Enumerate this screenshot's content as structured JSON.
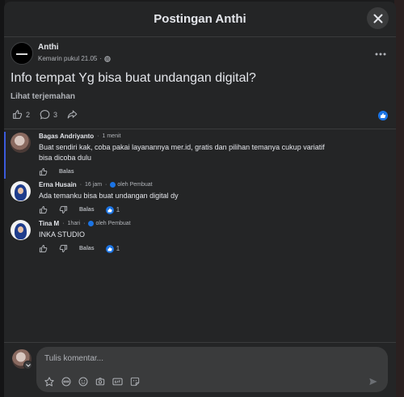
{
  "modal": {
    "title": "Postingan Anthi"
  },
  "post": {
    "author": "Anthi",
    "time": "Kemarin pukul 21.05",
    "text": "Info tempat Yg bisa buat undangan digital?",
    "translate": "Lihat terjemahan",
    "like_count": "2",
    "comment_count": "3"
  },
  "comments": [
    {
      "name": "Bagas Andriyanto",
      "time": "1 menit",
      "text_line1": "Buat sendiri kak, coba pakai layanannya mer.id, gratis dan pilihan temanya cukup variatif",
      "text_line2": "bisa dicoba dulu",
      "reply": "Balas"
    },
    {
      "name": "Erna Husain",
      "time": "16 jam",
      "author_tag": "oleh Pembuat",
      "text": "Ada temanku bisa buat undangan digital dy",
      "reply": "Balas",
      "reactions": "1"
    },
    {
      "name": "Tina M",
      "time": "1hari",
      "author_tag": "oleh Pembuat",
      "text": "INKA STUDIO",
      "reply": "Balas",
      "reactions": "1"
    }
  ],
  "composer": {
    "placeholder": "Tulis komentar..."
  },
  "colors": {
    "accent": "#1b74e4",
    "modal_bg": "#242526",
    "input_bg": "#3a3b3c"
  },
  "icons": [
    "close-icon",
    "globe-icon",
    "more-icon",
    "like-icon",
    "comment-icon",
    "share-icon",
    "dislike-icon",
    "chevron-down-icon",
    "avatar-icon",
    "emoji-icon",
    "camera-icon",
    "gif-icon",
    "sticker-icon",
    "send-icon"
  ]
}
